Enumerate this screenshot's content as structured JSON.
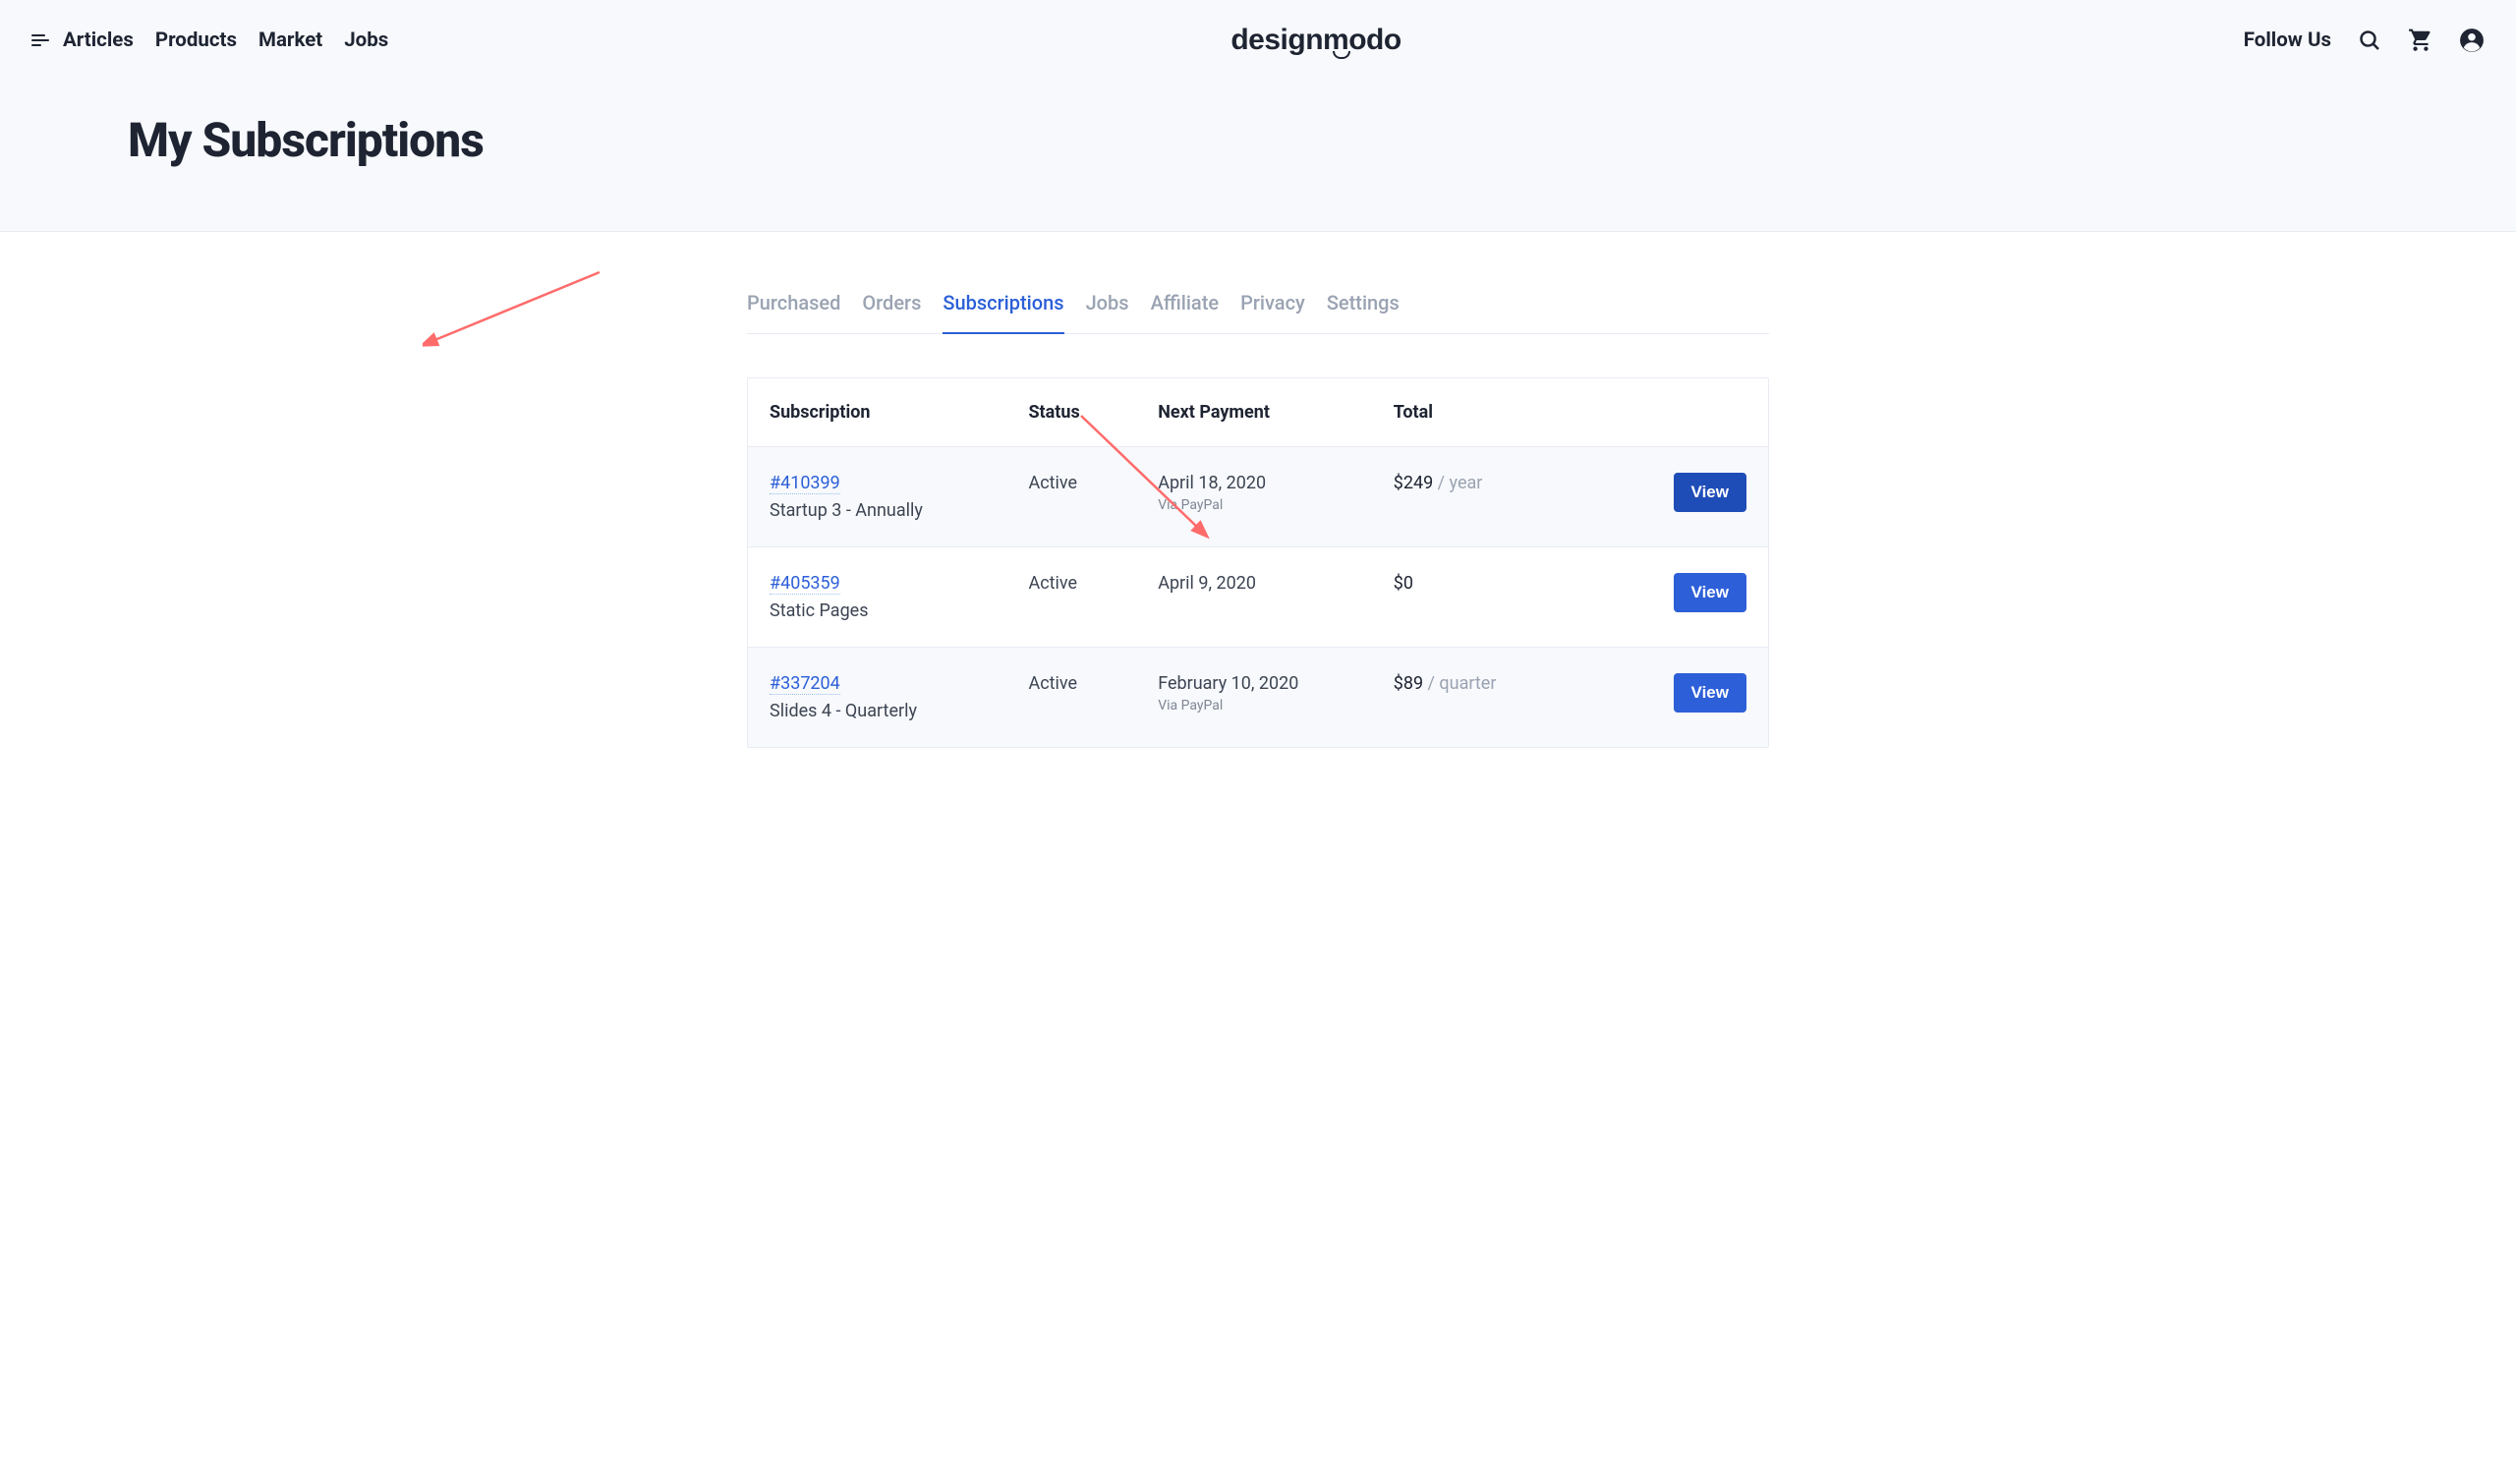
{
  "header": {
    "nav": [
      "Articles",
      "Products",
      "Market",
      "Jobs"
    ],
    "logo": "designmodo",
    "follow": "Follow Us"
  },
  "page": {
    "title": "My Subscriptions"
  },
  "tabs": {
    "items": [
      "Purchased",
      "Orders",
      "Subscriptions",
      "Jobs",
      "Affiliate",
      "Privacy",
      "Settings"
    ],
    "active_index": 2
  },
  "table": {
    "headers": {
      "subscription": "Subscription",
      "status": "Status",
      "next_payment": "Next Payment",
      "total": "Total"
    },
    "rows": [
      {
        "id": "#410399",
        "name": "Startup 3 - Annually",
        "status": "Active",
        "next_payment": "April 18, 2020",
        "via": "Via PayPal",
        "price": "$249",
        "period": " / year",
        "button": "View",
        "alt": true
      },
      {
        "id": "#405359",
        "name": "Static Pages",
        "status": "Active",
        "next_payment": "April 9, 2020",
        "via": "",
        "price": "$0",
        "period": "",
        "button": "View",
        "alt": false
      },
      {
        "id": "#337204",
        "name": "Slides 4 - Quarterly",
        "status": "Active",
        "next_payment": "February 10, 2020",
        "via": "Via PayPal",
        "price": "$89",
        "period": " / quarter",
        "button": "View",
        "alt": true
      }
    ]
  }
}
